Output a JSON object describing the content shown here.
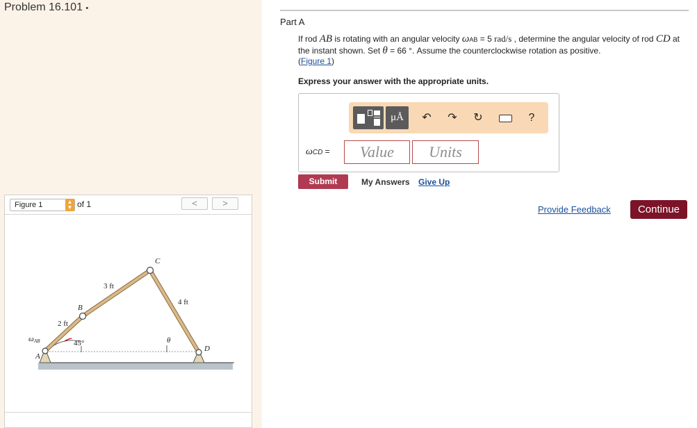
{
  "problem": {
    "title": "Problem 16.101",
    "bullet": "•"
  },
  "figure_panel": {
    "select_value": "Figure 1",
    "of_text": "of 1",
    "prev": "<",
    "next": ">",
    "labels": {
      "C": "C",
      "B": "B",
      "A": "A",
      "D": "D",
      "len_bc": "3 ft",
      "len_cd": "4 ft",
      "len_ab": "2 ft",
      "angle": "45°",
      "theta": "θ",
      "omega": "ω",
      "omega_sub": "AB"
    }
  },
  "part": {
    "title": "Part A"
  },
  "question": {
    "t1": "If rod ",
    "ab": "AB",
    "t2": " is rotating with an angular velocity ",
    "omega": "ω",
    "omega_sub": "AB",
    "t3": " = 5 ",
    "unit": "rad/s",
    "t4": " , determine the angular velocity of rod ",
    "cd": "CD",
    "t5": " at the instant shown. Set ",
    "theta": "θ",
    "t6": " = 66 °. Assume the counterclockwise rotation as positive.",
    "fig_open": "(",
    "fig_link": "Figure 1",
    "fig_close": ")"
  },
  "instruction": "Express your answer with the appropriate units.",
  "answer": {
    "omega": "ω",
    "sub": "CD",
    "eq": " =",
    "value_placeholder": "Value",
    "units_placeholder": "Units",
    "toolbar": {
      "mu_label": "μÅ",
      "help": "?"
    }
  },
  "actions": {
    "submit": "Submit",
    "my_answers": "My Answers",
    "give_up": "Give Up",
    "feedback": "Provide Feedback",
    "continue": "Continue"
  },
  "colors": {
    "left_bg": "#fcf3e8",
    "toolbar_bg": "#f9d9b5",
    "submit": "#b03a52",
    "continue": "#7b1428",
    "link": "#1a4f9c",
    "rod": "#d9b98c"
  }
}
